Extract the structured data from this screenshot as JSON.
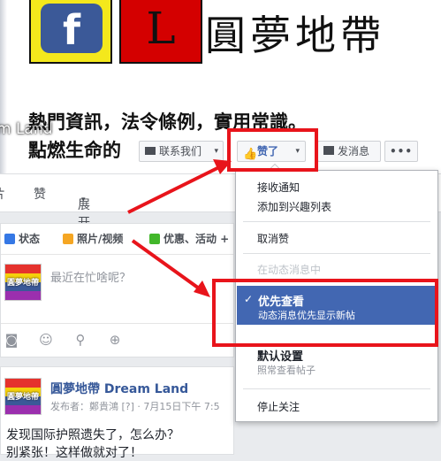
{
  "cover": {
    "fb_letter": "f",
    "l_letter": "L",
    "brand_title": "圓夢地帶",
    "subtitle_line1": "熱門資訊，法令條例，實用常識。",
    "subtitle_line2": "點燃生命的",
    "ghost_name": "m Land"
  },
  "actions": {
    "contact_label": "联系我们",
    "liked_label": "赞了",
    "message_label": "发消息",
    "more_label": "•••",
    "caret": "▾"
  },
  "subnav": {
    "item1": "片",
    "item2": "赞",
    "item3": "展开",
    "caret": "▾"
  },
  "composer": {
    "tab_status": "状态",
    "tab_photo": "照片/视频",
    "tab_offer": "优惠、活动 +",
    "placeholder": "最近在忙啥呢？",
    "avatar_text": "圓夢地帶",
    "tools": [
      "camera-icon",
      "emoji-icon",
      "location-icon",
      "target-icon"
    ]
  },
  "post": {
    "author": "圓夢地帶 Dream Land",
    "meta": "发布者：鄭貴鴻 [?] · 7月15日下午 7:5",
    "text_line1": "发现国际护照遗失了，怎么办？",
    "text_line2": "别紧张！这样做就对了！"
  },
  "dropdown": {
    "receive_notifications": "接收通知",
    "add_to_interest_list": "添加到兴趣列表",
    "unlike": "取消赞",
    "in_news_feed": "在动态消息中",
    "see_first_title": "优先查看",
    "see_first_sub": "动态消息优先显示新帖",
    "default_title": "默认设置",
    "default_sub": "照常查看帖子",
    "unfollow": "停止关注",
    "check": "✓"
  },
  "colors": {
    "facebook_blue": "#4267b2",
    "annotation_red": "#e8141b",
    "logo_yellow": "#f4e81c",
    "logo_red": "#d40000"
  }
}
